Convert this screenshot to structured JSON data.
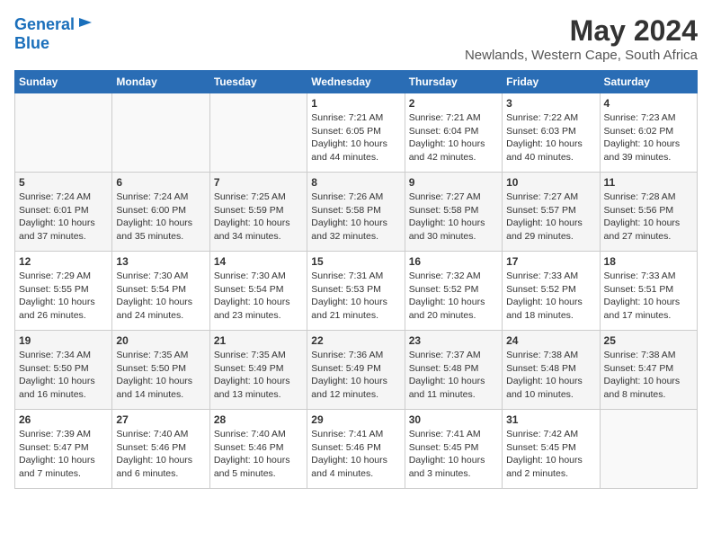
{
  "logo": {
    "line1": "General",
    "line2": "Blue"
  },
  "title": "May 2024",
  "location": "Newlands, Western Cape, South Africa",
  "days_of_week": [
    "Sunday",
    "Monday",
    "Tuesday",
    "Wednesday",
    "Thursday",
    "Friday",
    "Saturday"
  ],
  "weeks": [
    [
      {
        "day": "",
        "info": ""
      },
      {
        "day": "",
        "info": ""
      },
      {
        "day": "",
        "info": ""
      },
      {
        "day": "1",
        "info": "Sunrise: 7:21 AM\nSunset: 6:05 PM\nDaylight: 10 hours\nand 44 minutes."
      },
      {
        "day": "2",
        "info": "Sunrise: 7:21 AM\nSunset: 6:04 PM\nDaylight: 10 hours\nand 42 minutes."
      },
      {
        "day": "3",
        "info": "Sunrise: 7:22 AM\nSunset: 6:03 PM\nDaylight: 10 hours\nand 40 minutes."
      },
      {
        "day": "4",
        "info": "Sunrise: 7:23 AM\nSunset: 6:02 PM\nDaylight: 10 hours\nand 39 minutes."
      }
    ],
    [
      {
        "day": "5",
        "info": "Sunrise: 7:24 AM\nSunset: 6:01 PM\nDaylight: 10 hours\nand 37 minutes."
      },
      {
        "day": "6",
        "info": "Sunrise: 7:24 AM\nSunset: 6:00 PM\nDaylight: 10 hours\nand 35 minutes."
      },
      {
        "day": "7",
        "info": "Sunrise: 7:25 AM\nSunset: 5:59 PM\nDaylight: 10 hours\nand 34 minutes."
      },
      {
        "day": "8",
        "info": "Sunrise: 7:26 AM\nSunset: 5:58 PM\nDaylight: 10 hours\nand 32 minutes."
      },
      {
        "day": "9",
        "info": "Sunrise: 7:27 AM\nSunset: 5:58 PM\nDaylight: 10 hours\nand 30 minutes."
      },
      {
        "day": "10",
        "info": "Sunrise: 7:27 AM\nSunset: 5:57 PM\nDaylight: 10 hours\nand 29 minutes."
      },
      {
        "day": "11",
        "info": "Sunrise: 7:28 AM\nSunset: 5:56 PM\nDaylight: 10 hours\nand 27 minutes."
      }
    ],
    [
      {
        "day": "12",
        "info": "Sunrise: 7:29 AM\nSunset: 5:55 PM\nDaylight: 10 hours\nand 26 minutes."
      },
      {
        "day": "13",
        "info": "Sunrise: 7:30 AM\nSunset: 5:54 PM\nDaylight: 10 hours\nand 24 minutes."
      },
      {
        "day": "14",
        "info": "Sunrise: 7:30 AM\nSunset: 5:54 PM\nDaylight: 10 hours\nand 23 minutes."
      },
      {
        "day": "15",
        "info": "Sunrise: 7:31 AM\nSunset: 5:53 PM\nDaylight: 10 hours\nand 21 minutes."
      },
      {
        "day": "16",
        "info": "Sunrise: 7:32 AM\nSunset: 5:52 PM\nDaylight: 10 hours\nand 20 minutes."
      },
      {
        "day": "17",
        "info": "Sunrise: 7:33 AM\nSunset: 5:52 PM\nDaylight: 10 hours\nand 18 minutes."
      },
      {
        "day": "18",
        "info": "Sunrise: 7:33 AM\nSunset: 5:51 PM\nDaylight: 10 hours\nand 17 minutes."
      }
    ],
    [
      {
        "day": "19",
        "info": "Sunrise: 7:34 AM\nSunset: 5:50 PM\nDaylight: 10 hours\nand 16 minutes."
      },
      {
        "day": "20",
        "info": "Sunrise: 7:35 AM\nSunset: 5:50 PM\nDaylight: 10 hours\nand 14 minutes."
      },
      {
        "day": "21",
        "info": "Sunrise: 7:35 AM\nSunset: 5:49 PM\nDaylight: 10 hours\nand 13 minutes."
      },
      {
        "day": "22",
        "info": "Sunrise: 7:36 AM\nSunset: 5:49 PM\nDaylight: 10 hours\nand 12 minutes."
      },
      {
        "day": "23",
        "info": "Sunrise: 7:37 AM\nSunset: 5:48 PM\nDaylight: 10 hours\nand 11 minutes."
      },
      {
        "day": "24",
        "info": "Sunrise: 7:38 AM\nSunset: 5:48 PM\nDaylight: 10 hours\nand 10 minutes."
      },
      {
        "day": "25",
        "info": "Sunrise: 7:38 AM\nSunset: 5:47 PM\nDaylight: 10 hours\nand 8 minutes."
      }
    ],
    [
      {
        "day": "26",
        "info": "Sunrise: 7:39 AM\nSunset: 5:47 PM\nDaylight: 10 hours\nand 7 minutes."
      },
      {
        "day": "27",
        "info": "Sunrise: 7:40 AM\nSunset: 5:46 PM\nDaylight: 10 hours\nand 6 minutes."
      },
      {
        "day": "28",
        "info": "Sunrise: 7:40 AM\nSunset: 5:46 PM\nDaylight: 10 hours\nand 5 minutes."
      },
      {
        "day": "29",
        "info": "Sunrise: 7:41 AM\nSunset: 5:46 PM\nDaylight: 10 hours\nand 4 minutes."
      },
      {
        "day": "30",
        "info": "Sunrise: 7:41 AM\nSunset: 5:45 PM\nDaylight: 10 hours\nand 3 minutes."
      },
      {
        "day": "31",
        "info": "Sunrise: 7:42 AM\nSunset: 5:45 PM\nDaylight: 10 hours\nand 2 minutes."
      },
      {
        "day": "",
        "info": ""
      }
    ]
  ]
}
